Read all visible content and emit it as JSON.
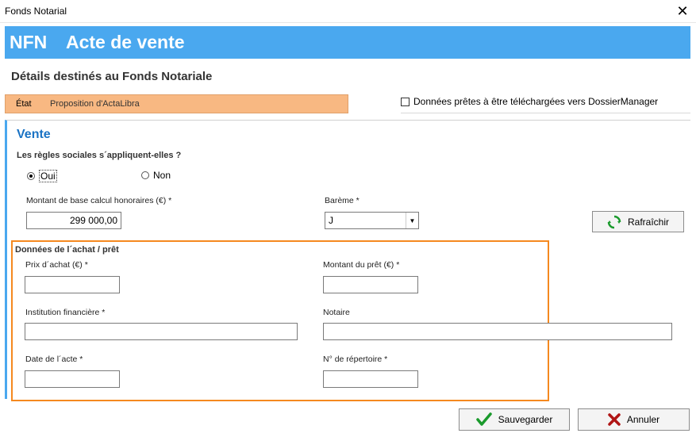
{
  "window": {
    "title": "Fonds Notarial",
    "close_icon": "close-icon"
  },
  "banner": {
    "code": "NFN",
    "name": "Acte de vente",
    "color": "#4aa8ef"
  },
  "details_title": "Détails destinés au Fonds Notariale",
  "state": {
    "label": "État",
    "value": "Proposition d'ActaLibra",
    "color": "#f8b882"
  },
  "ready": {
    "label": "Données prêtes à être téléchargées vers DossierManager",
    "checked": false
  },
  "section": {
    "title": "Vente"
  },
  "social_rules": {
    "question": "Les règles sociales s´appliquent-elles ?",
    "options": [
      {
        "label": "Oui",
        "selected": true
      },
      {
        "label": "Non",
        "selected": false
      }
    ]
  },
  "base_amount": {
    "label": "Montant de base calcul honoraires (€) *",
    "value": "299 000,00"
  },
  "bareme": {
    "label": "Barème *",
    "value": "J"
  },
  "refresh_button": {
    "label": "Rafraîchir",
    "icon": "refresh-icon"
  },
  "purchase_group": {
    "title": "Données de l´achat / prêt",
    "fields": {
      "purchase_price": {
        "label": "Prix d´achat (€) *",
        "value": ""
      },
      "loan_amount": {
        "label": "Montant du prêt (€) *",
        "value": ""
      },
      "financial_institution": {
        "label": "Institution financière *",
        "value": ""
      },
      "notary": {
        "label": "Notaire",
        "value": ""
      },
      "deed_date": {
        "label": "Date de l´acte *",
        "value": ""
      },
      "repertoire_no": {
        "label": "N° de répertoire *",
        "value": ""
      }
    },
    "border_color": "#f5891f"
  },
  "footer": {
    "save": {
      "label": "Sauvegarder",
      "icon": "checkmark-icon"
    },
    "cancel": {
      "label": "Annuler",
      "icon": "cross-icon"
    }
  }
}
